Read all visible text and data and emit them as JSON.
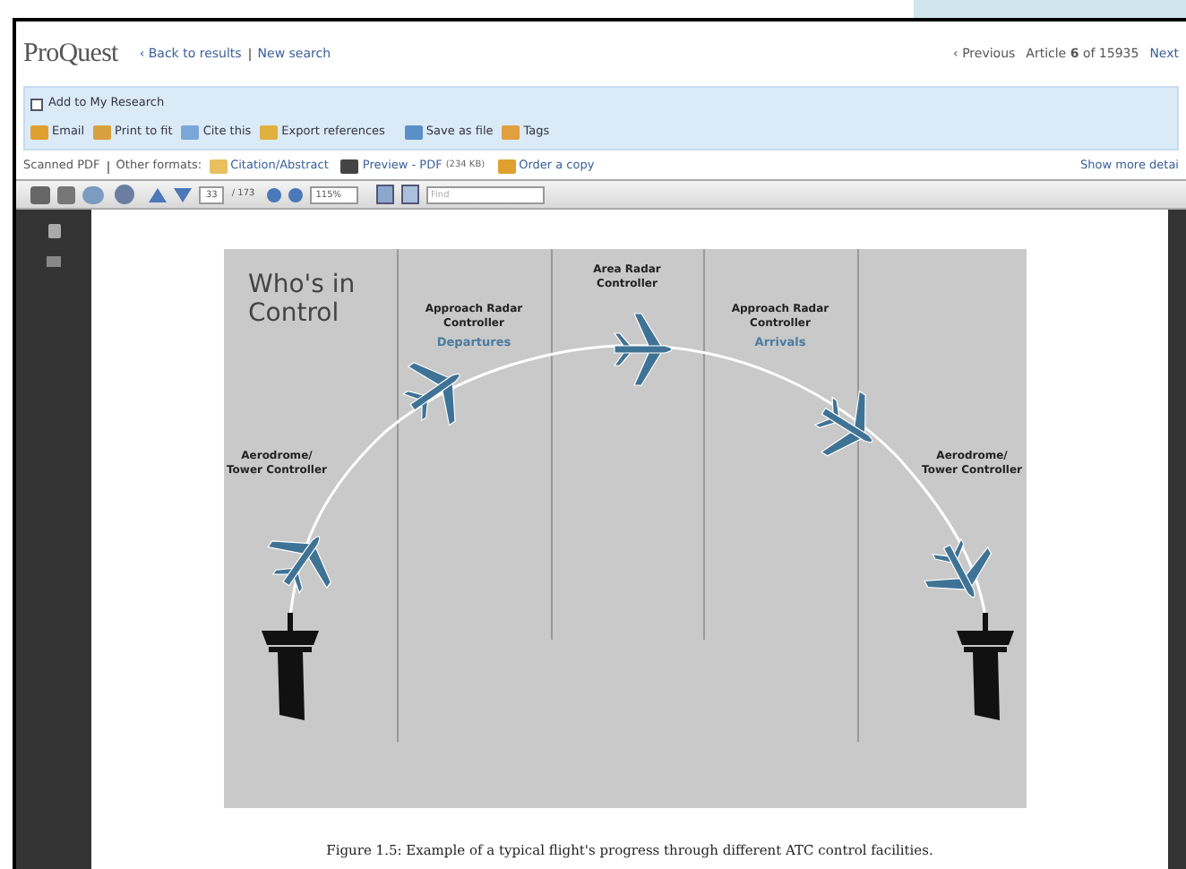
{
  "header": {
    "logo": "ProQuest",
    "links": [
      "‹ Back to results",
      "New search"
    ],
    "previous": "‹ Previous",
    "article": "Article **6** of 15935",
    "next": "Next"
  },
  "research": {
    "label": "Add to My Research",
    "checked": false
  },
  "actions": [
    {
      "kind": "email",
      "label": "Email"
    },
    {
      "kind": "print",
      "label": "Print to fit"
    },
    {
      "kind": "cite",
      "label": "Cite this"
    },
    {
      "kind": "export",
      "label": "Export references"
    },
    {
      "kind": "save",
      "label": "Save as file"
    },
    {
      "kind": "tags",
      "label": "Tags"
    }
  ],
  "formats": {
    "current": "Scanned PDF",
    "label": "Other formats:",
    "links": [
      {
        "kind": "citation",
        "label": "Citation/Abstract"
      },
      {
        "kind": "preview",
        "label": "Preview - PDF",
        "size": "(234 KB)"
      },
      {
        "kind": "order",
        "label": "Order a copy"
      }
    ],
    "more": "Show more detai"
  },
  "toolbar": {
    "page": "33",
    "total": "/ 173",
    "zoom": "115%",
    "find_placeholder": "Find"
  },
  "figure": {
    "title": "Who's in\nControl",
    "columns": [
      {
        "label": "Aerodrome/\nTower Controller"
      },
      {
        "label": "Approach Radar\nController",
        "sub": "Departures"
      },
      {
        "label": "Area Radar\nController"
      },
      {
        "label": "Approach Radar\nController",
        "sub": "Arrivals"
      },
      {
        "label": "Aerodrome/\nTower Controller"
      }
    ],
    "caption": "Figure 1.5: Example of a typical flight's progress through different ATC control facilities."
  }
}
